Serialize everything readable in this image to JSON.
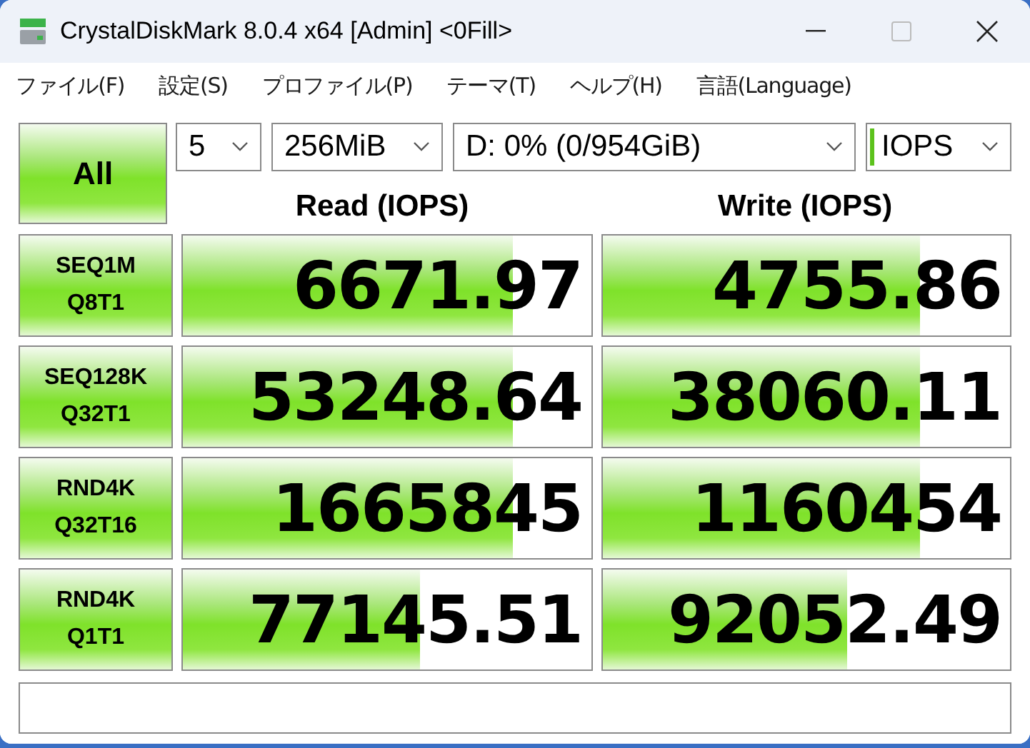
{
  "window": {
    "title": "CrystalDiskMark 8.0.4 x64 [Admin] <0Fill>"
  },
  "menu": [
    "ファイル(F)",
    "設定(S)",
    "プロファイル(P)",
    "テーマ(T)",
    "ヘルプ(H)",
    "言語(Language)"
  ],
  "all_button": "All",
  "selects": [
    {
      "value": "5"
    },
    {
      "value": "256MiB"
    },
    {
      "value": "D: 0% (0/954GiB)"
    },
    {
      "value": "IOPS"
    }
  ],
  "headers": [
    "Read (IOPS)",
    "Write (IOPS)"
  ],
  "rows": [
    {
      "line1": "SEQ1M",
      "line2": "Q8T1",
      "read": {
        "value": "6671.97",
        "level": 0.81
      },
      "write": {
        "value": "4755.86",
        "level": 0.78
      }
    },
    {
      "line1": "SEQ128K",
      "line2": "Q32T1",
      "read": {
        "value": "53248.64",
        "level": 0.81
      },
      "write": {
        "value": "38060.11",
        "level": 0.78
      }
    },
    {
      "line1": "RND4K",
      "line2": "Q32T16",
      "read": {
        "value": "1665845",
        "level": 0.81
      },
      "write": {
        "value": "1160454",
        "level": 0.78
      }
    },
    {
      "line1": "RND4K",
      "line2": "Q1T1",
      "read": {
        "value": "77145.51",
        "level": 0.58
      },
      "write": {
        "value": "92052.49",
        "level": 0.6
      }
    }
  ]
}
